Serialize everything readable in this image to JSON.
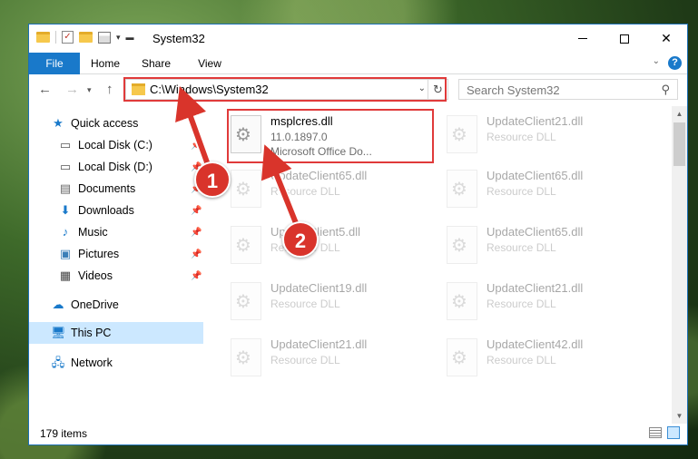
{
  "window": {
    "title": "System32"
  },
  "ribbon": {
    "tabs": [
      "File",
      "Home",
      "Share",
      "View"
    ]
  },
  "address": {
    "path": "C:\\Windows\\System32"
  },
  "search": {
    "placeholder": "Search System32"
  },
  "nav": {
    "quick_access": "Quick access",
    "items": [
      {
        "label": "Local Disk (C:)",
        "icon": "drive-icon",
        "pinned": true
      },
      {
        "label": "Local Disk (D:)",
        "icon": "drive-icon",
        "pinned": true
      },
      {
        "label": "Documents",
        "icon": "documents-icon",
        "pinned": true
      },
      {
        "label": "Downloads",
        "icon": "downloads-icon",
        "pinned": true
      },
      {
        "label": "Music",
        "icon": "music-icon",
        "pinned": true
      },
      {
        "label": "Pictures",
        "icon": "pictures-icon",
        "pinned": true
      },
      {
        "label": "Videos",
        "icon": "videos-icon",
        "pinned": true
      }
    ],
    "onedrive": "OneDrive",
    "this_pc": "This PC",
    "network": "Network"
  },
  "files": {
    "selected": {
      "name": "msplcres.dll",
      "version": "11.0.1897.0",
      "description": "Microsoft Office Do..."
    },
    "left_column": [
      {
        "name": "UpdateClient65.dll",
        "type": "Resource DLL"
      },
      {
        "name": "UpdateClient5.dll",
        "type": "Resource DLL"
      },
      {
        "name": "UpdateClient19.dll",
        "type": "Resource DLL"
      },
      {
        "name": "UpdateClient21.dll",
        "type": "Resource DLL"
      }
    ],
    "right_column": [
      {
        "name": "UpdateClient21.dll",
        "type": "Resource DLL"
      },
      {
        "name": "UpdateClient65.dll",
        "type": "Resource DLL"
      },
      {
        "name": "UpdateClient65.dll",
        "type": "Resource DLL"
      },
      {
        "name": "UpdateClient21.dll",
        "type": "Resource DLL"
      },
      {
        "name": "UpdateClient42.dll",
        "type": "Resource DLL"
      }
    ]
  },
  "status": {
    "count": "179 items"
  },
  "callouts": {
    "one": "1",
    "two": "2"
  },
  "colors": {
    "accent": "#1979ca",
    "highlight": "#e03a3a",
    "callout": "#d9342b"
  }
}
